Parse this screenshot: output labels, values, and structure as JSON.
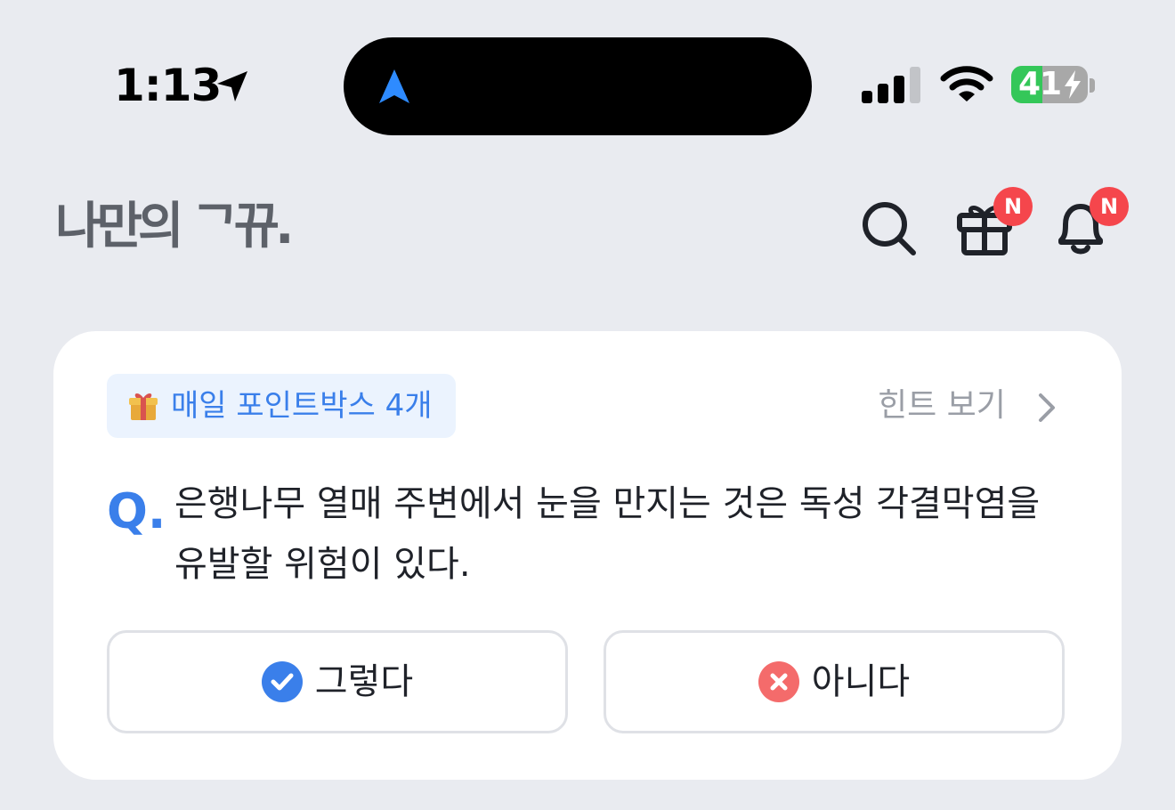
{
  "status_bar": {
    "time": "1:13",
    "battery_level": 41,
    "battery_percent": 0.41,
    "charging": true,
    "icons": [
      "location-arrow-icon",
      "navigation-icon",
      "cellular-signal-icon",
      "wifi-icon",
      "battery-icon",
      "charging-bolt-icon"
    ]
  },
  "header": {
    "logo_text": "나만의 ᄀ뀨.",
    "icons": [
      "search-icon",
      "gift-icon",
      "bell-icon"
    ],
    "gift_badge": "N",
    "bell_badge": "N",
    "logo_color": "#5d6169",
    "badge_color": "#f5464c"
  },
  "quiz": {
    "points_chip": {
      "icon": "gift-box-icon",
      "label": "매일 포인트박스 4개"
    },
    "hint_label": "힌트 보기",
    "q_mark": "Q.",
    "question": "은행나무 열매 주변에서 눈을 만지는 것은 독성 각결막염을 유발할 위험이 있다.",
    "answers": [
      {
        "label": "그렇다",
        "icon": "check-circle-icon",
        "color": "#3a7fea"
      },
      {
        "label": "아니다",
        "icon": "x-circle-icon",
        "color": "#f46b6b"
      }
    ],
    "accent_color": "#3a7fea"
  }
}
